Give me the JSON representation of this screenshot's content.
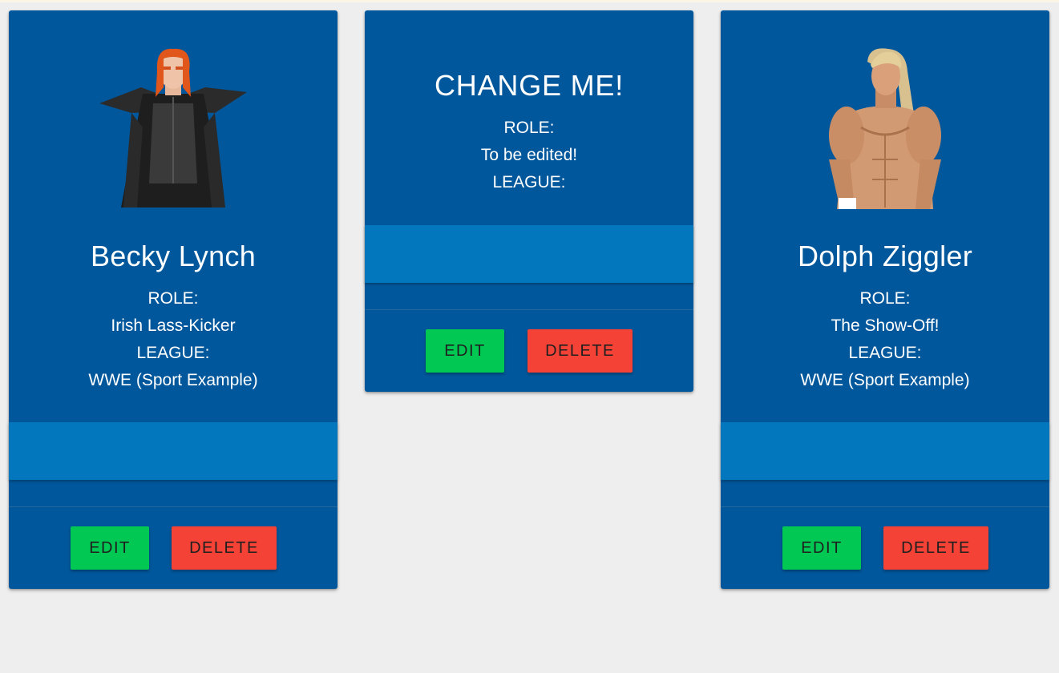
{
  "cards": [
    {
      "name": "Becky Lynch",
      "role_label": "ROLE:",
      "role": "Irish Lass-Kicker",
      "league_label": "LEAGUE:",
      "league": "WWE (Sport Example)",
      "has_image": true,
      "edit_label": "EDIT",
      "delete_label": "DELETE"
    },
    {
      "name": "CHANGE ME!",
      "role_label": "ROLE:",
      "role": "To be edited!",
      "league_label": "LEAGUE:",
      "league": "",
      "has_image": false,
      "edit_label": "EDIT",
      "delete_label": "DELETE"
    },
    {
      "name": "Dolph Ziggler",
      "role_label": "ROLE:",
      "role": "The Show-Off!",
      "league_label": "LEAGUE:",
      "league": "WWE (Sport Example)",
      "has_image": true,
      "edit_label": "EDIT",
      "delete_label": "DELETE"
    }
  ],
  "colors": {
    "card": "#01579b",
    "band": "#0277bd",
    "edit": "#00c853",
    "delete": "#f44336",
    "background": "#eeeeee"
  }
}
